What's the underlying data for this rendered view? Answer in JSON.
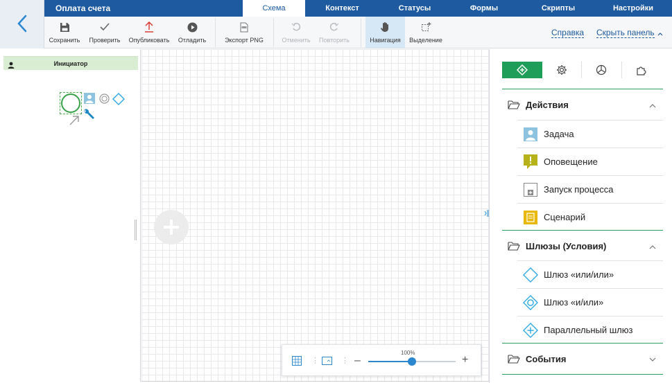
{
  "app": {
    "title": "Оплата счета"
  },
  "tabs": [
    {
      "label": "Схема",
      "active": true
    },
    {
      "label": "Контекст"
    },
    {
      "label": "Статусы"
    },
    {
      "label": "Формы"
    },
    {
      "label": "Скрипты"
    },
    {
      "label": "Настройки"
    }
  ],
  "toolbar": {
    "save": "Сохранить",
    "check": "Проверить",
    "publish": "Опубликовать",
    "debug": "Отладить",
    "export_png": "Экспорт PNG",
    "undo": "Отменить",
    "redo": "Повторить",
    "navigation": "Навигация",
    "selection": "Выделение",
    "help": "Справка",
    "hide_panel": "Скрыть панель"
  },
  "lane": {
    "title": "Инициатор"
  },
  "zoom": {
    "level": "100%",
    "value": 0.5
  },
  "panel": {
    "sections": [
      {
        "title": "Действия",
        "expanded": true,
        "items": [
          "Задача",
          "Оповещение",
          "Запуск процесса",
          "Сценарий"
        ]
      },
      {
        "title": "Шлюзы (Условия)",
        "expanded": true,
        "items": [
          "Шлюз «или/или»",
          "Шлюз «и/или»",
          "Параллельный шлюз"
        ]
      },
      {
        "title": "События",
        "expanded": false,
        "items": []
      }
    ]
  },
  "colors": {
    "brand": "#1d5aa0",
    "accent_green": "#1f9e5a",
    "lane_header": "#d9edd3",
    "gateway_cyan": "#29a9e0"
  }
}
